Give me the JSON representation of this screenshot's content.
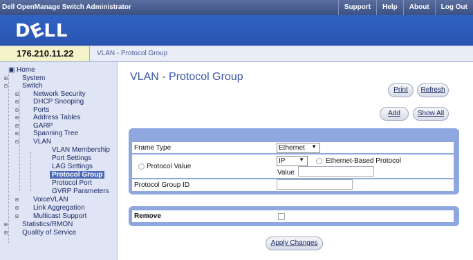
{
  "header": {
    "app_title": "Dell OpenManage Switch Administrator",
    "links": [
      "Support",
      "Help",
      "About",
      "Log Out"
    ],
    "logo": "DELL"
  },
  "address": {
    "ip": "176.210.11.22",
    "breadcrumb": "VLAN - Protocol Group"
  },
  "sidebar": {
    "items": [
      {
        "label": "Home"
      },
      {
        "label": "System"
      },
      {
        "label": "Switch"
      },
      {
        "label": "Network Security"
      },
      {
        "label": "DHCP Snooping"
      },
      {
        "label": "Ports"
      },
      {
        "label": "Address Tables"
      },
      {
        "label": "GARP"
      },
      {
        "label": "Spanning Tree"
      },
      {
        "label": "VLAN"
      },
      {
        "label": "VLAN Membership"
      },
      {
        "label": "Port Settings"
      },
      {
        "label": "LAG Settings"
      },
      {
        "label": "Protocol Group"
      },
      {
        "label": "Protocol Port"
      },
      {
        "label": "GVRP Parameters"
      },
      {
        "label": "VoiceVLAN"
      },
      {
        "label": "Link Aggregation"
      },
      {
        "label": "Multicast Support"
      },
      {
        "label": "Statistics/RMON"
      },
      {
        "label": "Quality of Service"
      }
    ]
  },
  "main": {
    "title": "VLAN - Protocol Group",
    "buttons": {
      "print": "Print",
      "refresh": "Refresh",
      "add": "Add",
      "show_all": "Show All",
      "apply": "Apply Changes"
    },
    "form": {
      "frame_type_label": "Frame Type",
      "frame_type_value": "Ethernet",
      "protocol_value_label": "Protocol Value",
      "protocol_value_select": "IP",
      "ethernet_based_label": "Ethernet-Based Protocol",
      "value_label": "Value",
      "value_input": "",
      "group_id_label": "Protocol Group ID",
      "group_id_input": "",
      "remove_label": "Remove"
    }
  },
  "colors": {
    "accent": "#2f63c4",
    "panel": "#8ea7df",
    "title": "#3a54a5",
    "selected": "#4f6bb8"
  }
}
